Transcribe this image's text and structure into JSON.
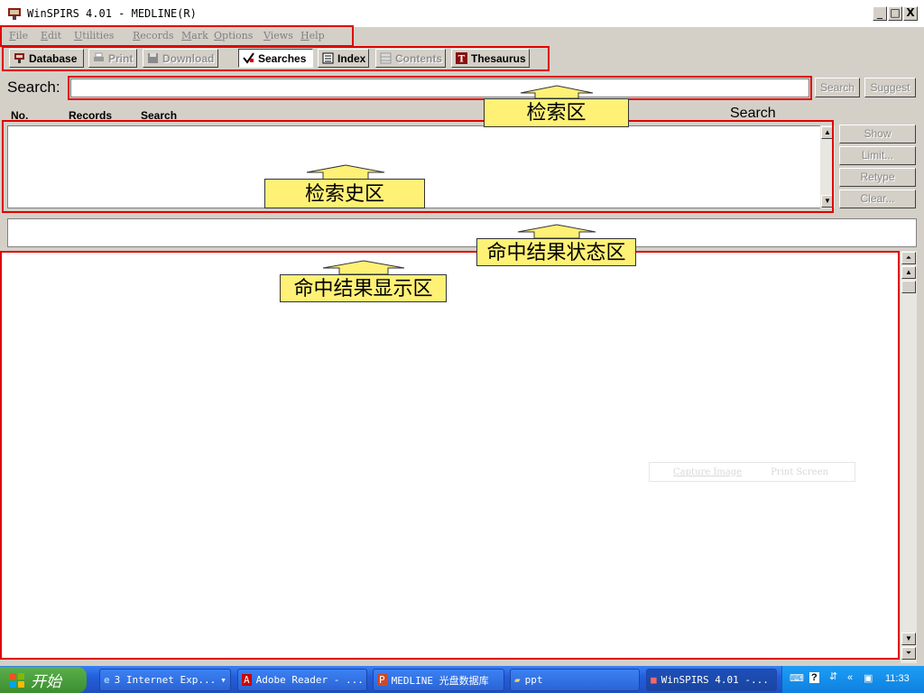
{
  "window": {
    "title": "WinSPIRS 4.01 - MEDLINE(R)",
    "min": "_",
    "max": "□",
    "close": "X"
  },
  "menu": [
    "File",
    "Edit",
    "Utilities",
    "Records",
    "Mark",
    "Options",
    "Views",
    "Help"
  ],
  "toolbar": {
    "database": "Database",
    "print": "Print",
    "download": "Download",
    "searches": "Searches",
    "index": "Index",
    "contents": "Contents",
    "thesaurus": "Thesaurus"
  },
  "search": {
    "label": "Search:",
    "value": "",
    "search_button": "Search",
    "suggest_button": "Suggest"
  },
  "history": {
    "columns": {
      "no": "No.",
      "records": "Records",
      "search": "Search",
      "search2": "Search"
    },
    "buttons": {
      "show": "Show",
      "limit": "Limit...",
      "retype": "Retype",
      "clear": "Clear..."
    }
  },
  "annotations": {
    "search_area": "检索区",
    "history_area": "检索史区",
    "status_area": "命中结果状态区",
    "results_area": "命中结果显示区",
    "color": "#fff176",
    "box_color": "#e00000"
  },
  "capture_bar": {
    "capture": "Capture Image",
    "print_screen": "Print Screen"
  },
  "taskbar": {
    "start": "开始",
    "tasks": [
      "3 Internet Exp...",
      "Adobe Reader - ...",
      "MEDLINE 光盘数据库",
      "ppt",
      "WinSPIRS 4.01 -..."
    ],
    "clock": "11:33"
  }
}
